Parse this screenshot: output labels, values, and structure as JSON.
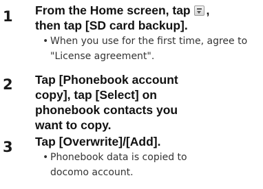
{
  "steps": [
    {
      "number": "1",
      "instruction_before_icon": "From the Home screen, tap ",
      "icon": "menu-icon",
      "instruction_after_icon": ",",
      "instruction_line2": "then tap [SD card backup].",
      "note": "When you use for the first time, agree to \"License agreement\"."
    },
    {
      "number": "2",
      "instruction": "Tap [Phonebook account copy], tap [Select] on phonebook contacts you want to copy."
    },
    {
      "number": "3",
      "instruction": "Tap [Overwrite]/[Add].",
      "note": "Phonebook data is copied to docomo account."
    }
  ],
  "bullet_char": "•"
}
